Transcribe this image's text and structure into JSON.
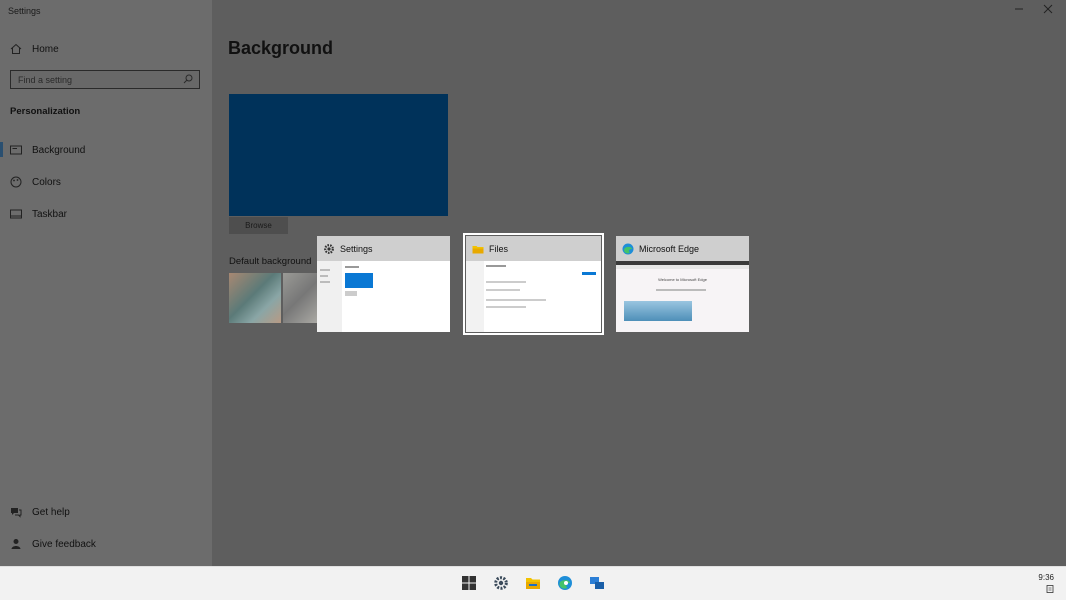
{
  "window": {
    "title": "Settings",
    "minimize_icon": "minimize-icon",
    "close_icon": "close-icon"
  },
  "sidebar": {
    "home_label": "Home",
    "search_placeholder": "Find a setting",
    "section_label": "Personalization",
    "items": [
      {
        "label": "Background",
        "icon": "image-icon",
        "selected": true
      },
      {
        "label": "Colors",
        "icon": "palette-icon",
        "selected": false
      },
      {
        "label": "Taskbar",
        "icon": "taskbar-icon",
        "selected": false
      }
    ],
    "footer": [
      {
        "label": "Get help",
        "icon": "help-icon"
      },
      {
        "label": "Give feedback",
        "icon": "feedback-icon"
      }
    ]
  },
  "main": {
    "title": "Background",
    "preview_color": "#00325a",
    "browse_label": "Browse",
    "default_backgrounds_label": "Default background"
  },
  "task_view": {
    "windows": [
      {
        "title": "Settings",
        "icon": "gear-icon",
        "selected": false
      },
      {
        "title": "Files",
        "icon": "folder-icon",
        "selected": true
      },
      {
        "title": "Microsoft Edge",
        "icon": "edge-icon",
        "selected": false
      }
    ],
    "edge_page_heading": "Welcome to Microsoft Edge"
  },
  "taskbar": {
    "icons": [
      "windows-logo-icon",
      "settings-icon",
      "file-explorer-icon",
      "edge-icon",
      "task-view-icon"
    ],
    "clock": "9:36"
  }
}
